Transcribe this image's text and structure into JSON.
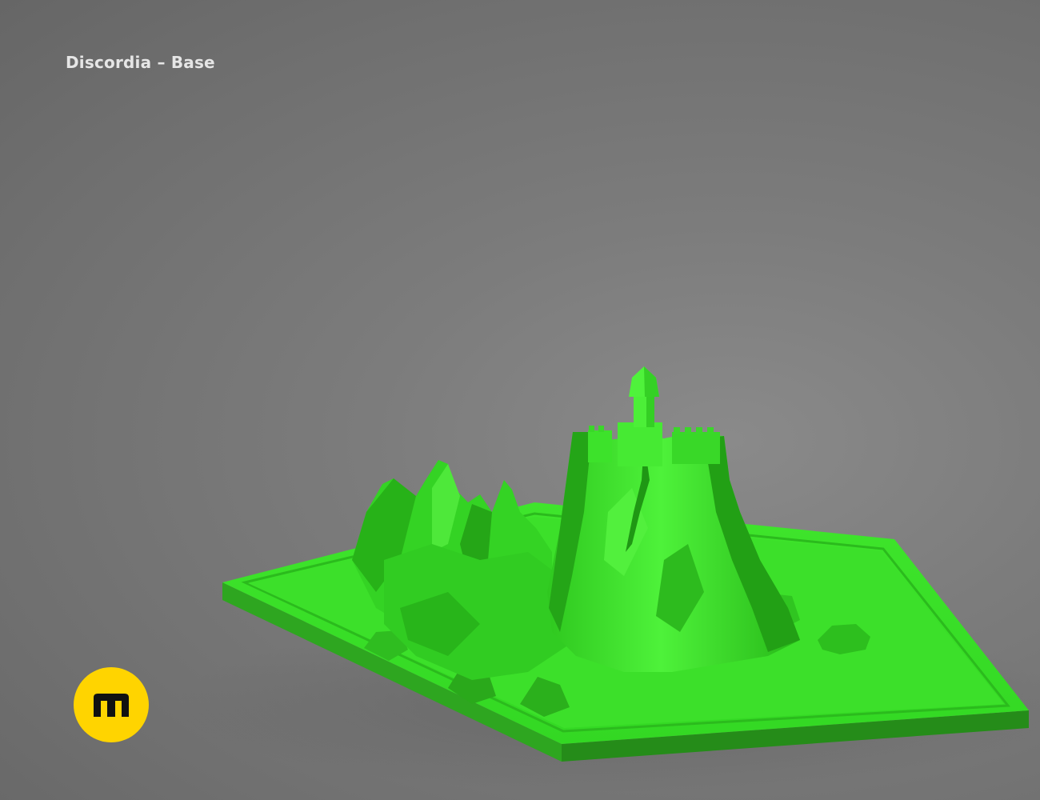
{
  "scene": {
    "title": "Discordia – Base",
    "subject": "green 3D printed terrain base with castle on a rocky mountain"
  },
  "colors": {
    "background": "#7a7a7a",
    "model_green": "#33dd22",
    "model_green_dark": "#1c9a10",
    "model_green_light": "#5ff54a",
    "logo_yellow": "#ffd400",
    "logo_mark": "#111111",
    "title_text": "#e6e6e6"
  },
  "logo": {
    "icon": "m-brand-logo-icon"
  }
}
